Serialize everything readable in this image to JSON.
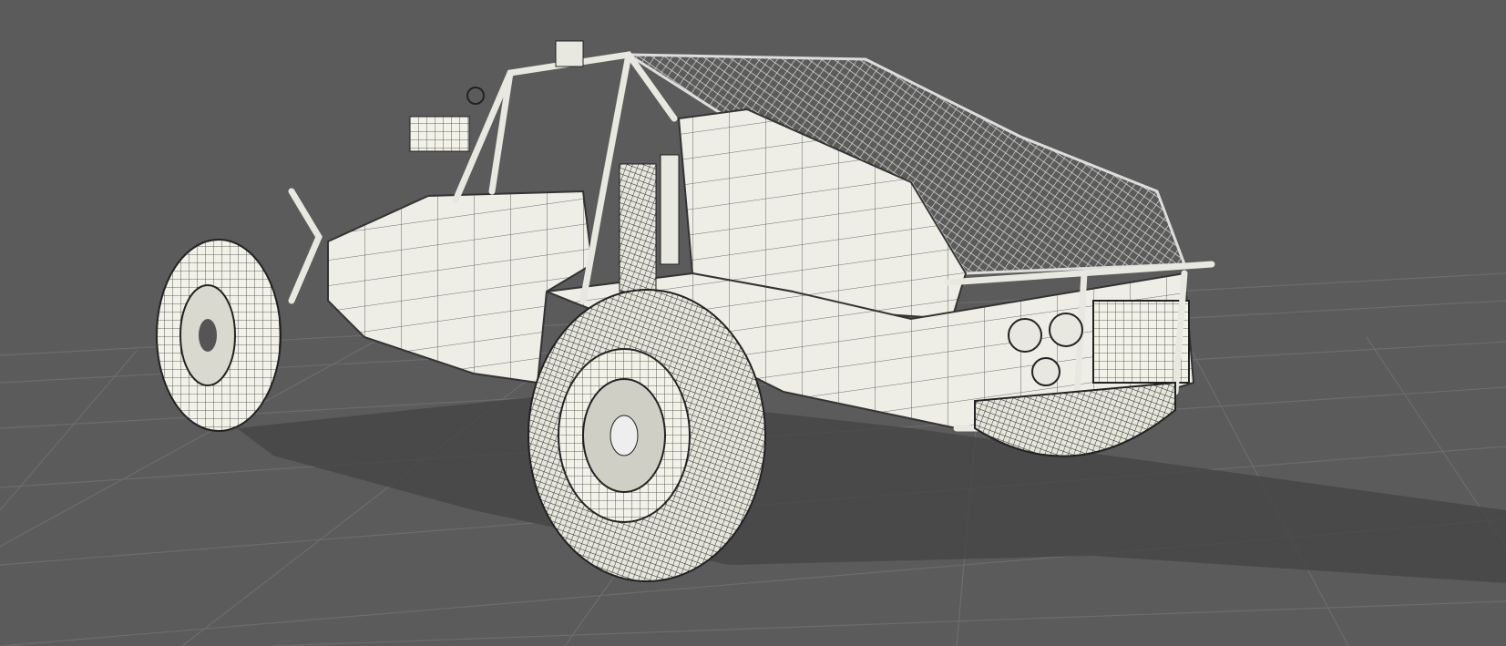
{
  "scene": {
    "subject": "dune-buggy-wireframe-model",
    "colors": {
      "background": "#5b5b5b",
      "grid_line": "#6c6c6c",
      "shadow": "#474747",
      "mesh_surface": "#f2f2e8",
      "wire": "#2a2a2a"
    }
  }
}
